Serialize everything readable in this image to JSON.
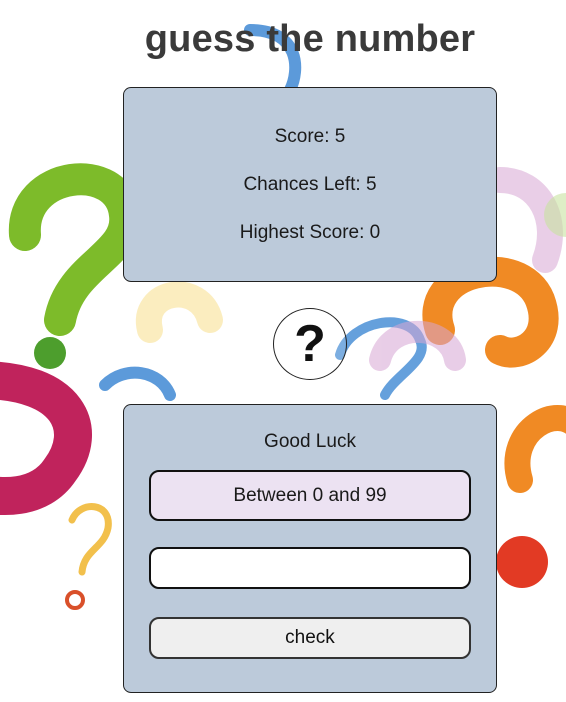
{
  "page": {
    "title": "guess the number"
  },
  "score_card": {
    "score": "Score: 5",
    "chances": "Chances Left: 5",
    "highest": "Highest Score: 0"
  },
  "mystery": {
    "symbol": "?"
  },
  "game": {
    "message": "Good Luck",
    "hint": "Between 0 and 99",
    "guess_value": "",
    "check_label": "check"
  },
  "colors": {
    "card_bg": "#bccada",
    "hint_bg": "#ece2f2",
    "button_bg": "#efefef",
    "title": "#3a3a3a"
  }
}
